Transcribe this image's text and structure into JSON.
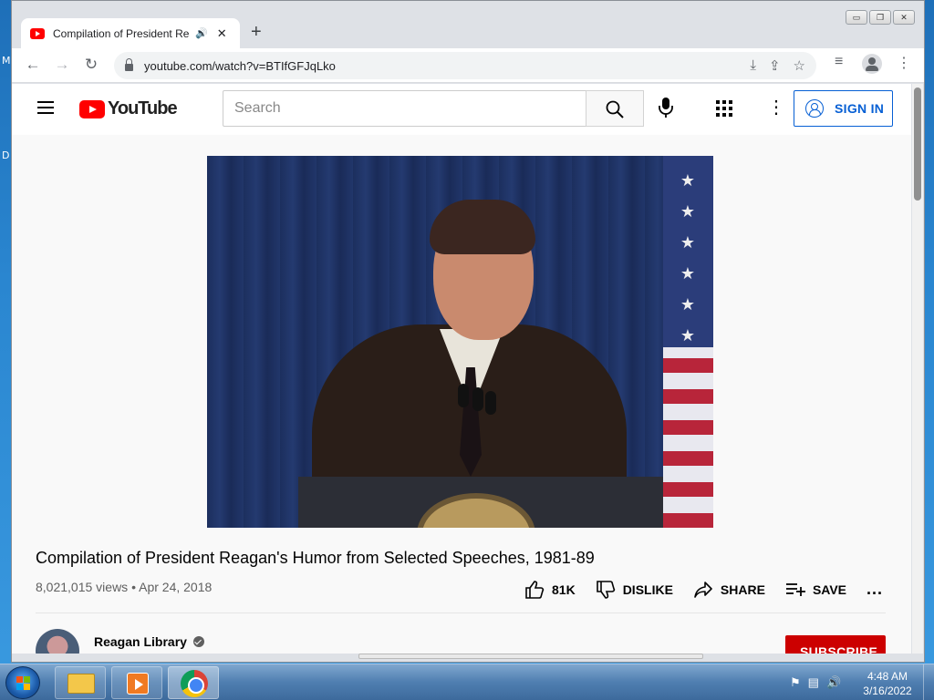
{
  "desktop": {
    "fragment_1": "M",
    "fragment_2": "D"
  },
  "browser": {
    "tab": {
      "title": "Compilation of President Rea",
      "audio_icon": "speaker-icon",
      "close_icon": "close-icon"
    },
    "new_tab_glyph": "+",
    "window_controls": {
      "minimize": "▭",
      "restore": "❐",
      "close": "✕"
    },
    "nav": {
      "back": "←",
      "forward": "→",
      "reload": "↻"
    },
    "url": "youtube.com/watch?v=BTIfGFJqLko",
    "toolbar_icons": [
      "install-icon",
      "share-icon",
      "star-icon",
      "media-queue-icon",
      "profile-icon",
      "menu-icon"
    ]
  },
  "youtube": {
    "logo_text": "YouTube",
    "search": {
      "placeholder": "Search"
    },
    "sign_in_label": "SIGN IN",
    "video": {
      "title": "Compilation of President Reagan's Humor from Selected Speeches, 1981-89",
      "views": "8,021,015 views",
      "separator": "•",
      "date": "Apr 24, 2018",
      "likes": "81K",
      "dislike_label": "DISLIKE",
      "share_label": "SHARE",
      "save_label": "SAVE",
      "more": "..."
    },
    "channel": {
      "name": "Reagan Library",
      "subscribe_label": "SUBSCRIBE"
    }
  },
  "taskbar": {
    "clock_time": "4:48 AM",
    "clock_date": "3/16/2022",
    "apps": [
      "file-explorer",
      "media-player",
      "chrome"
    ]
  },
  "colors": {
    "youtube_red": "#ff0000",
    "link_blue": "#065fd4",
    "subscribe_red": "#cc0000"
  }
}
